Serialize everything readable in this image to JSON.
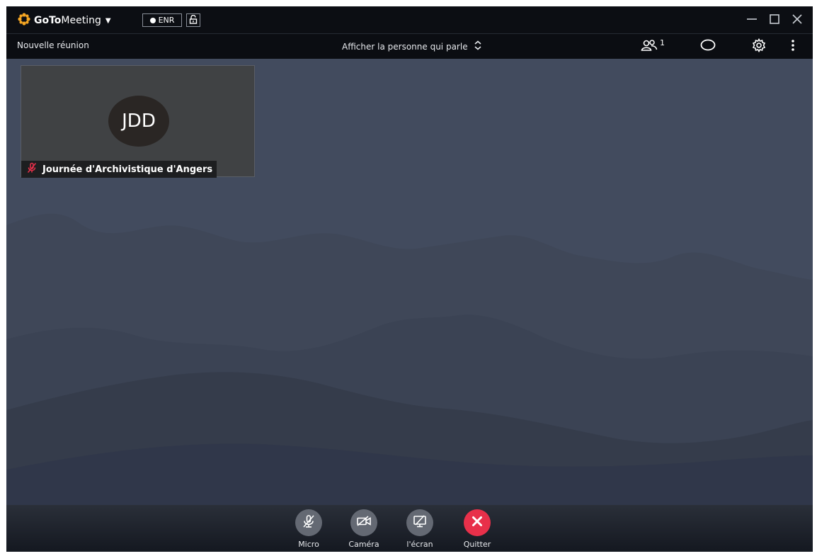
{
  "app": {
    "brand_bold": "GoTo",
    "brand_rest": "Meeting"
  },
  "titlebar": {
    "record_label": "ENR"
  },
  "toolbar": {
    "meeting_title": "Nouvelle réunion",
    "view_mode": "Afficher la personne qui parle",
    "participants_count": "1"
  },
  "tile": {
    "initials": "JDD",
    "participant_name": "Journée d'Archivistique d'Angers"
  },
  "controls": {
    "micro": "Micro",
    "camera": "Caméra",
    "screen": "l'écran",
    "quit": "Quitter"
  },
  "colors": {
    "logo_orange": "#f5a623",
    "quit_red": "#e8304a",
    "muted_red": "#e8304a",
    "stage_bg": "#424b5e"
  }
}
